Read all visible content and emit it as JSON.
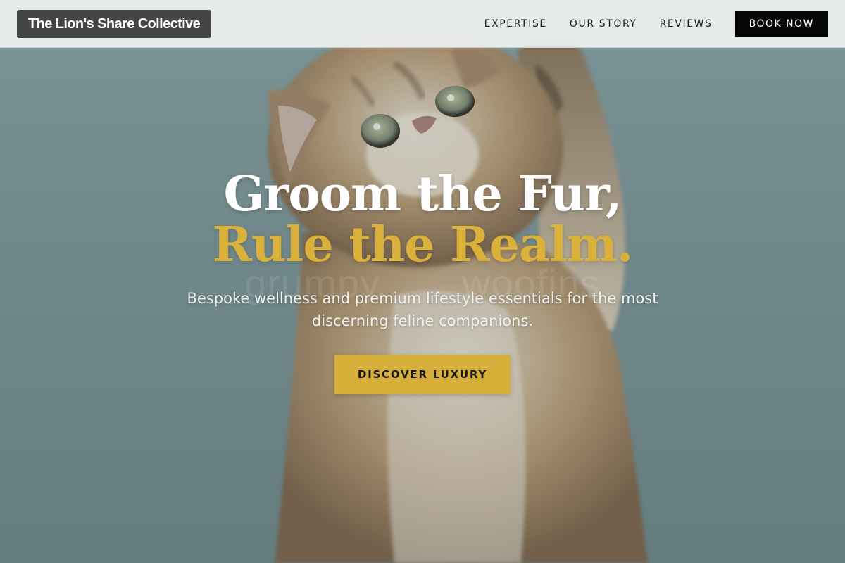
{
  "header": {
    "brand": "The Lion's Share Collective",
    "nav": [
      {
        "label": "EXPERTISE"
      },
      {
        "label": "OUR STORY"
      },
      {
        "label": "REVIEWS"
      }
    ],
    "cta_label": "BOOK NOW"
  },
  "hero": {
    "title_line1": "Groom the Fur,",
    "title_line2": "Rule the Realm.",
    "subtitle": "Bespoke wellness and premium lifestyle essentials for the most discerning feline companions.",
    "cta_label": "DISCOVER LUXURY",
    "image_subject": "kitten-reaching-up-photo"
  },
  "colors": {
    "accent_gold": "#d6ae3a",
    "header_bg": "#eef1f1",
    "brand_bg": "#454545",
    "book_button_bg": "#050505",
    "hero_bg": "#7d9698"
  }
}
